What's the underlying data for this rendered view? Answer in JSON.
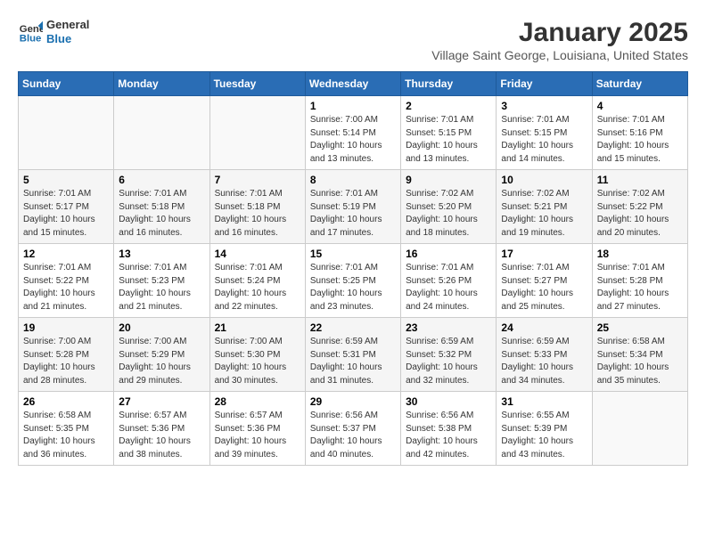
{
  "header": {
    "logo_line1": "General",
    "logo_line2": "Blue",
    "month": "January 2025",
    "location": "Village Saint George, Louisiana, United States"
  },
  "weekdays": [
    "Sunday",
    "Monday",
    "Tuesday",
    "Wednesday",
    "Thursday",
    "Friday",
    "Saturday"
  ],
  "weeks": [
    [
      {
        "day": null,
        "detail": null
      },
      {
        "day": null,
        "detail": null
      },
      {
        "day": null,
        "detail": null
      },
      {
        "day": "1",
        "detail": "Sunrise: 7:00 AM\nSunset: 5:14 PM\nDaylight: 10 hours\nand 13 minutes."
      },
      {
        "day": "2",
        "detail": "Sunrise: 7:01 AM\nSunset: 5:15 PM\nDaylight: 10 hours\nand 13 minutes."
      },
      {
        "day": "3",
        "detail": "Sunrise: 7:01 AM\nSunset: 5:15 PM\nDaylight: 10 hours\nand 14 minutes."
      },
      {
        "day": "4",
        "detail": "Sunrise: 7:01 AM\nSunset: 5:16 PM\nDaylight: 10 hours\nand 15 minutes."
      }
    ],
    [
      {
        "day": "5",
        "detail": "Sunrise: 7:01 AM\nSunset: 5:17 PM\nDaylight: 10 hours\nand 15 minutes."
      },
      {
        "day": "6",
        "detail": "Sunrise: 7:01 AM\nSunset: 5:18 PM\nDaylight: 10 hours\nand 16 minutes."
      },
      {
        "day": "7",
        "detail": "Sunrise: 7:01 AM\nSunset: 5:18 PM\nDaylight: 10 hours\nand 16 minutes."
      },
      {
        "day": "8",
        "detail": "Sunrise: 7:01 AM\nSunset: 5:19 PM\nDaylight: 10 hours\nand 17 minutes."
      },
      {
        "day": "9",
        "detail": "Sunrise: 7:02 AM\nSunset: 5:20 PM\nDaylight: 10 hours\nand 18 minutes."
      },
      {
        "day": "10",
        "detail": "Sunrise: 7:02 AM\nSunset: 5:21 PM\nDaylight: 10 hours\nand 19 minutes."
      },
      {
        "day": "11",
        "detail": "Sunrise: 7:02 AM\nSunset: 5:22 PM\nDaylight: 10 hours\nand 20 minutes."
      }
    ],
    [
      {
        "day": "12",
        "detail": "Sunrise: 7:01 AM\nSunset: 5:22 PM\nDaylight: 10 hours\nand 21 minutes."
      },
      {
        "day": "13",
        "detail": "Sunrise: 7:01 AM\nSunset: 5:23 PM\nDaylight: 10 hours\nand 21 minutes."
      },
      {
        "day": "14",
        "detail": "Sunrise: 7:01 AM\nSunset: 5:24 PM\nDaylight: 10 hours\nand 22 minutes."
      },
      {
        "day": "15",
        "detail": "Sunrise: 7:01 AM\nSunset: 5:25 PM\nDaylight: 10 hours\nand 23 minutes."
      },
      {
        "day": "16",
        "detail": "Sunrise: 7:01 AM\nSunset: 5:26 PM\nDaylight: 10 hours\nand 24 minutes."
      },
      {
        "day": "17",
        "detail": "Sunrise: 7:01 AM\nSunset: 5:27 PM\nDaylight: 10 hours\nand 25 minutes."
      },
      {
        "day": "18",
        "detail": "Sunrise: 7:01 AM\nSunset: 5:28 PM\nDaylight: 10 hours\nand 27 minutes."
      }
    ],
    [
      {
        "day": "19",
        "detail": "Sunrise: 7:00 AM\nSunset: 5:28 PM\nDaylight: 10 hours\nand 28 minutes."
      },
      {
        "day": "20",
        "detail": "Sunrise: 7:00 AM\nSunset: 5:29 PM\nDaylight: 10 hours\nand 29 minutes."
      },
      {
        "day": "21",
        "detail": "Sunrise: 7:00 AM\nSunset: 5:30 PM\nDaylight: 10 hours\nand 30 minutes."
      },
      {
        "day": "22",
        "detail": "Sunrise: 6:59 AM\nSunset: 5:31 PM\nDaylight: 10 hours\nand 31 minutes."
      },
      {
        "day": "23",
        "detail": "Sunrise: 6:59 AM\nSunset: 5:32 PM\nDaylight: 10 hours\nand 32 minutes."
      },
      {
        "day": "24",
        "detail": "Sunrise: 6:59 AM\nSunset: 5:33 PM\nDaylight: 10 hours\nand 34 minutes."
      },
      {
        "day": "25",
        "detail": "Sunrise: 6:58 AM\nSunset: 5:34 PM\nDaylight: 10 hours\nand 35 minutes."
      }
    ],
    [
      {
        "day": "26",
        "detail": "Sunrise: 6:58 AM\nSunset: 5:35 PM\nDaylight: 10 hours\nand 36 minutes."
      },
      {
        "day": "27",
        "detail": "Sunrise: 6:57 AM\nSunset: 5:36 PM\nDaylight: 10 hours\nand 38 minutes."
      },
      {
        "day": "28",
        "detail": "Sunrise: 6:57 AM\nSunset: 5:36 PM\nDaylight: 10 hours\nand 39 minutes."
      },
      {
        "day": "29",
        "detail": "Sunrise: 6:56 AM\nSunset: 5:37 PM\nDaylight: 10 hours\nand 40 minutes."
      },
      {
        "day": "30",
        "detail": "Sunrise: 6:56 AM\nSunset: 5:38 PM\nDaylight: 10 hours\nand 42 minutes."
      },
      {
        "day": "31",
        "detail": "Sunrise: 6:55 AM\nSunset: 5:39 PM\nDaylight: 10 hours\nand 43 minutes."
      },
      {
        "day": null,
        "detail": null
      }
    ]
  ]
}
